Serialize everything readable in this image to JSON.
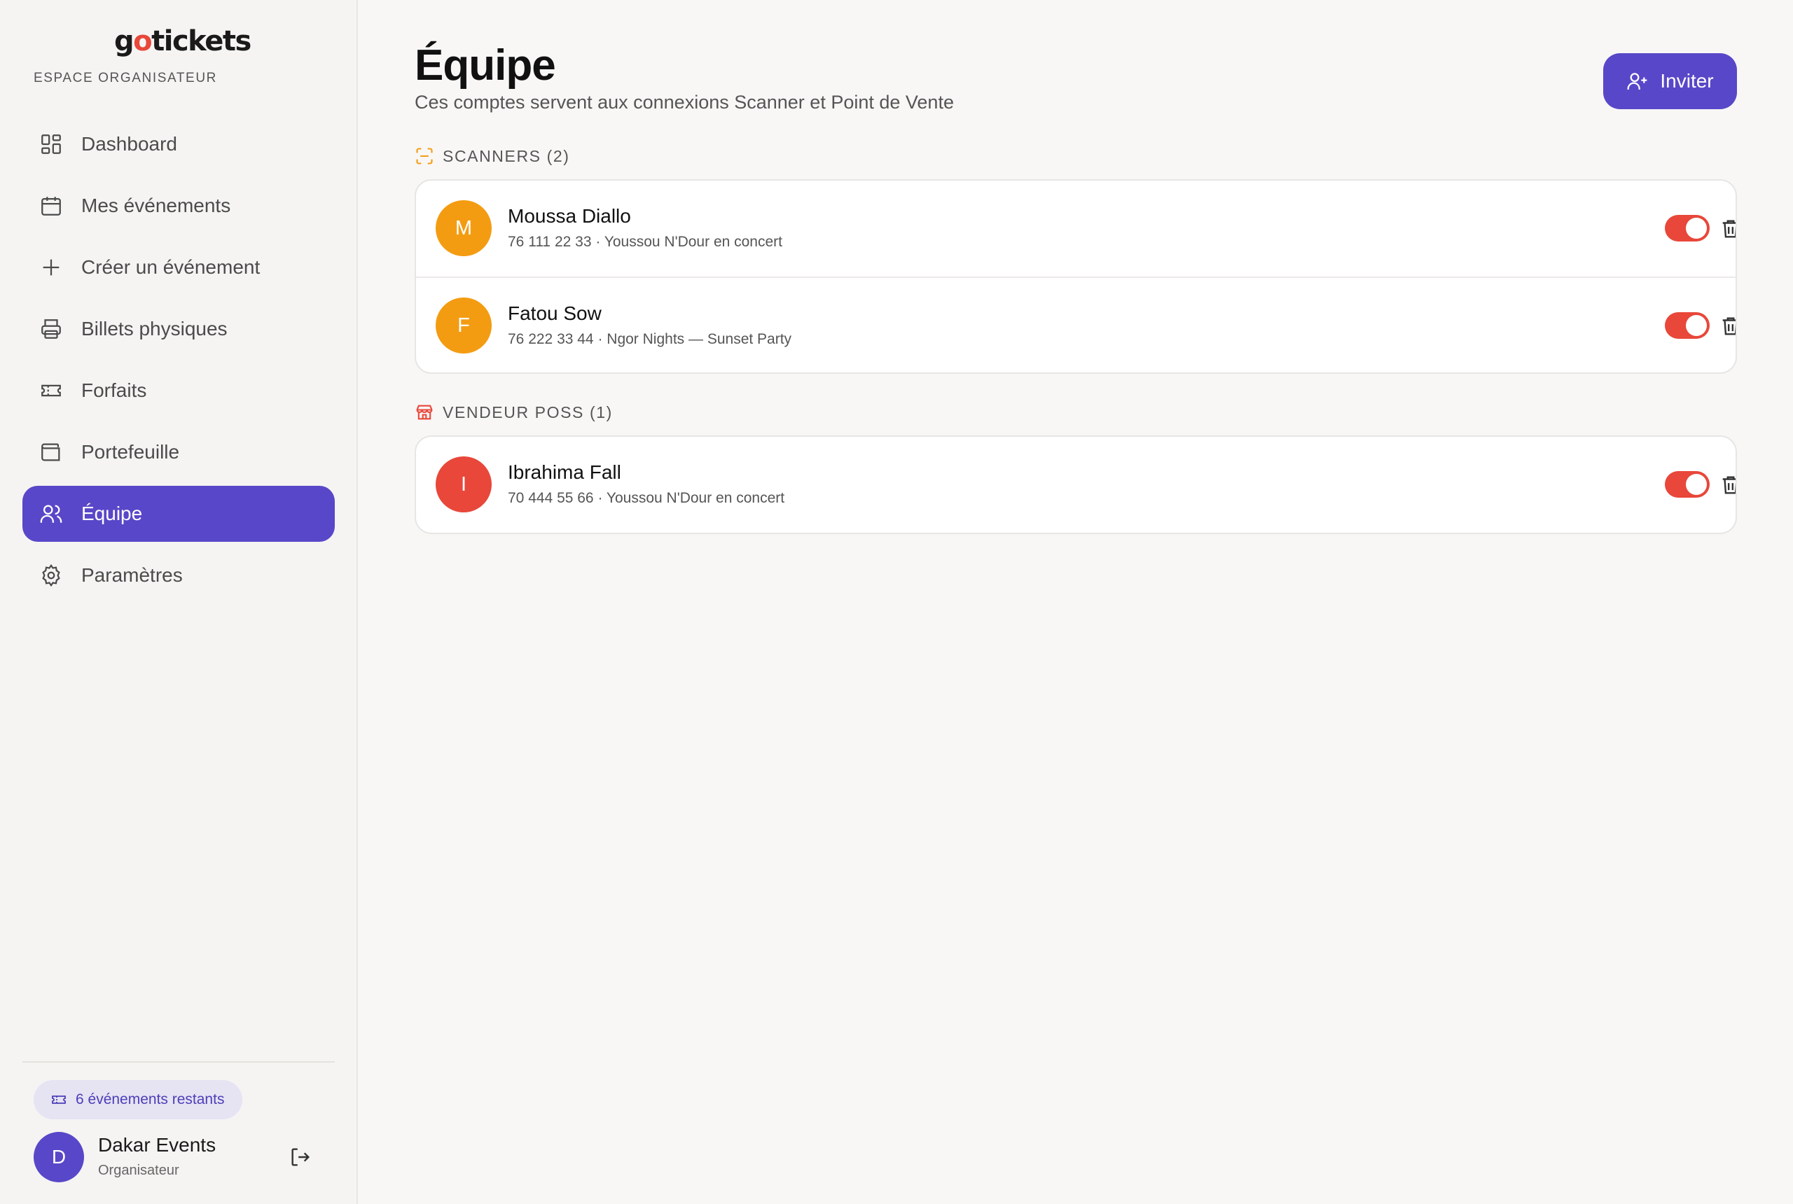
{
  "brand": {
    "logo_pre": "g",
    "logo_o": "o",
    "logo_post": "tickets",
    "subtitle": "ESPACE ORGANISATEUR"
  },
  "nav": [
    {
      "label": "Dashboard",
      "icon": "dashboard-icon",
      "active": false
    },
    {
      "label": "Mes événements",
      "icon": "calendar-icon",
      "active": false
    },
    {
      "label": "Créer un événement",
      "icon": "plus-icon",
      "active": false
    },
    {
      "label": "Billets physiques",
      "icon": "printer-icon",
      "active": false
    },
    {
      "label": "Forfaits",
      "icon": "ticket-icon",
      "active": false
    },
    {
      "label": "Portefeuille",
      "icon": "wallet-icon",
      "active": false
    },
    {
      "label": "Équipe",
      "icon": "users-icon",
      "active": true
    },
    {
      "label": "Paramètres",
      "icon": "settings-icon",
      "active": false
    }
  ],
  "footer": {
    "remaining": "6 événements restants",
    "user_initial": "D",
    "user_name": "Dakar Events",
    "user_role": "Organisateur"
  },
  "header": {
    "title": "Équipe",
    "subtitle": "Ces comptes servent aux connexions Scanner et Point de Vente",
    "invite_label": "Inviter"
  },
  "scanners": {
    "heading": "SCANNERS (2)",
    "members": [
      {
        "initial": "M",
        "name": "Moussa Diallo",
        "meta": "76 111 22 33 · Youssou N'Dour en concert",
        "color": "#f39c12",
        "enabled": true
      },
      {
        "initial": "F",
        "name": "Fatou Sow",
        "meta": "76 222 33 44 · Ngor Nights — Sunset Party",
        "color": "#f39c12",
        "enabled": true
      }
    ]
  },
  "vendeurs": {
    "heading": "VENDEUR POSS (1)",
    "members": [
      {
        "initial": "I",
        "name": "Ibrahima Fall",
        "meta": "70 444 55 66 · Youssou N'Dour en concert",
        "color": "#e8473a",
        "enabled": true
      }
    ]
  },
  "colors": {
    "accent": "#5847c8",
    "scanner": "#f39c12",
    "vendeur": "#e8473a",
    "toggle_on": "#e8473a"
  }
}
